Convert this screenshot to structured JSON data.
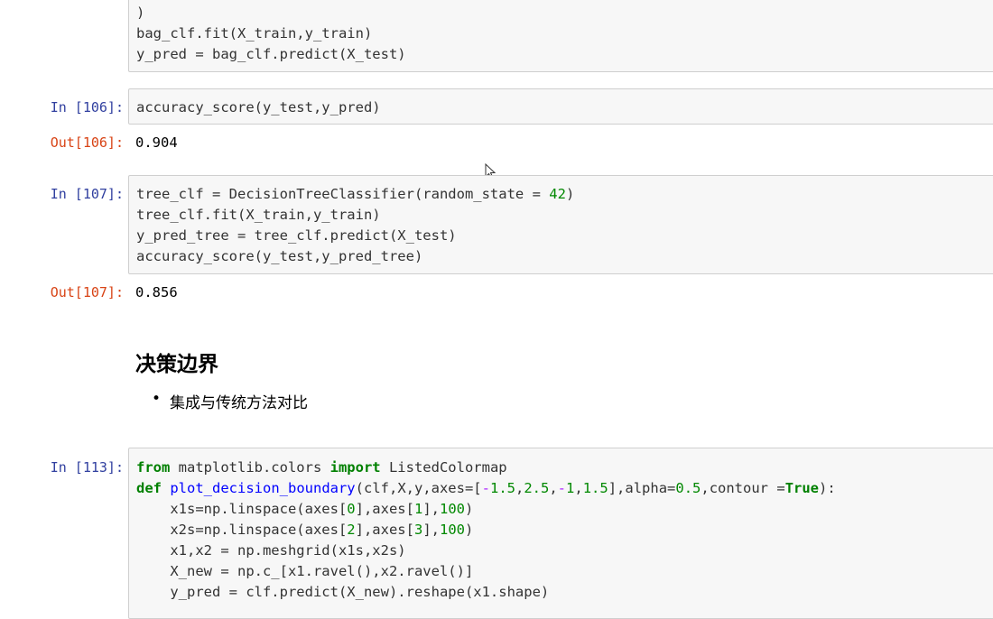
{
  "cell_top": {
    "lines": [
      ")",
      "bag_clf.fit(X_train,y_train)",
      "y_pred = bag_clf.predict(X_test)"
    ]
  },
  "cell_106": {
    "in_prompt": "In [106]:",
    "code": "accuracy_score(y_test,y_pred)",
    "out_prompt": "Out[106]:",
    "output": "0.904"
  },
  "cell_107": {
    "in_prompt": "In [107]:",
    "lines": [
      "tree_clf = DecisionTreeClassifier(random_state = 42)",
      "tree_clf.fit(X_train,y_train)",
      "y_pred_tree = tree_clf.predict(X_test)",
      "accuracy_score(y_test,y_pred_tree)"
    ],
    "out_prompt": "Out[107]:",
    "output": "0.856"
  },
  "markdown": {
    "heading": "决策边界",
    "bullet": "集成与传统方法对比"
  },
  "cell_113": {
    "in_prompt": "In [113]:",
    "lines": [
      "from matplotlib.colors import ListedColormap",
      "def plot_decision_boundary(clf,X,y,axes=[-1.5,2.5,-1,1.5],alpha=0.5,contour =True):",
      "    x1s=np.linspace(axes[0],axes[1],100)",
      "    x2s=np.linspace(axes[2],axes[3],100)",
      "    x1,x2 = np.meshgrid(x1s,x2s)",
      "    X_new = np.c_[x1.ravel(),x2.ravel()]",
      "    y_pred = clf.predict(X_new).reshape(x1.shape)"
    ]
  },
  "icons": {
    "cursor": "mouse-pointer-icon"
  },
  "colors": {
    "in_prompt": "#303f9f",
    "out_prompt": "#d84315",
    "keyword": "#008000",
    "function": "#0000ff",
    "number": "#008800"
  }
}
